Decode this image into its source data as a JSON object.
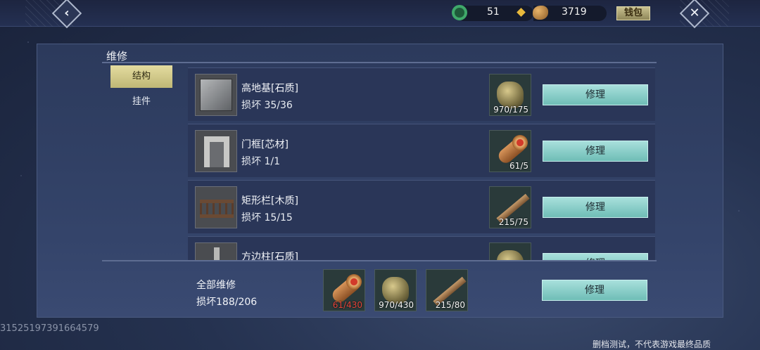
{
  "header": {
    "back_icon": "chevron-left-icon",
    "close_icon": "close-icon",
    "jade_amount": "51",
    "gourd_amount": "3719",
    "wallet_label": "钱包"
  },
  "panel": {
    "title": "维修",
    "tabs": [
      {
        "label": "结构",
        "active": true
      },
      {
        "label": "挂件",
        "active": false
      }
    ],
    "items": [
      {
        "name": "高地基[石质]",
        "damage": "损坏 35/36",
        "material_icon": "stone-ore-icon",
        "material_count": "970/175",
        "repair_label": "修理"
      },
      {
        "name": "门框[芯材]",
        "damage": "损坏 1/1",
        "material_icon": "log-icon",
        "material_count": "61/5",
        "repair_label": "修理"
      },
      {
        "name": "矩形栏[木质]",
        "damage": "损坏 15/15",
        "material_icon": "plank-icon",
        "material_count": "215/75",
        "repair_label": "修理"
      },
      {
        "name": "方边柱[石质]",
        "damage": "",
        "material_icon": "stone-ore-icon",
        "material_count": "",
        "repair_label": "修理"
      }
    ],
    "footer": {
      "title": "全部维修",
      "damage": "损坏188/206",
      "materials": [
        {
          "icon": "log-icon",
          "count": "61/430",
          "insufficient": true
        },
        {
          "icon": "stone-ore-icon",
          "count": "970/430",
          "insufficient": false
        },
        {
          "icon": "plank-icon",
          "count": "215/80",
          "insufficient": false
        }
      ],
      "repair_label": "修理"
    }
  },
  "watermark": "31525197391664579",
  "disclaimer": "删档测试，不代表游戏最终品质"
}
